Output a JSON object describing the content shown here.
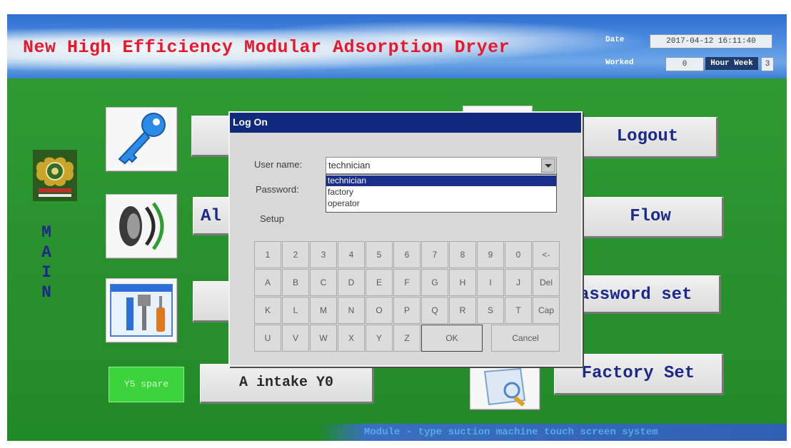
{
  "header": {
    "title": "New High Efficiency Modular Adsorption Dryer",
    "date_label": "Date",
    "date_value": "2017-04-12 16:11:40",
    "worked_label": "Worked",
    "worked_value": "0",
    "hour_week_label": "Hour Week",
    "week_value": "3"
  },
  "sidebar": {
    "main_letters": [
      "M",
      "A",
      "I",
      "N"
    ]
  },
  "menu": {
    "alarm_partial": "Al",
    "logout": "Logout",
    "flow": "Flow",
    "password_set": "assword set",
    "factory_set": "Factory Set",
    "intake": "A intake Y0",
    "y5_spare": "Y5 spare"
  },
  "dialog": {
    "title": "Log On",
    "username_label": "User name:",
    "password_label": "Password:",
    "setup_label": "Setup",
    "username_value": "technician",
    "user_options": [
      "technician",
      "factory",
      "operator"
    ],
    "selected_option": "technician",
    "keys": {
      "row1": [
        "1",
        "2",
        "3",
        "4",
        "5",
        "6",
        "7",
        "8",
        "9",
        "0",
        "<-"
      ],
      "row2": [
        "A",
        "B",
        "C",
        "D",
        "E",
        "F",
        "G",
        "H",
        "I",
        "J",
        "Del"
      ],
      "row3": [
        "K",
        "L",
        "M",
        "N",
        "O",
        "P",
        "Q",
        "R",
        "S",
        "T",
        "Cap"
      ],
      "row4": [
        "U",
        "V",
        "W",
        "X",
        "Y",
        "Z"
      ]
    },
    "ok_label": "OK",
    "cancel_label": "Cancel"
  },
  "footer": {
    "text": "Module - type suction machine touch screen system"
  },
  "colors": {
    "title_red": "#e8182a",
    "panel_green": "#2f9a32",
    "dialog_titlebar": "#0f2a7a",
    "button_text": "#1b2a8a"
  },
  "icons": [
    "key-icon",
    "speaker-icon",
    "tools-icon",
    "magnifier-icon",
    "logo-emblem"
  ]
}
